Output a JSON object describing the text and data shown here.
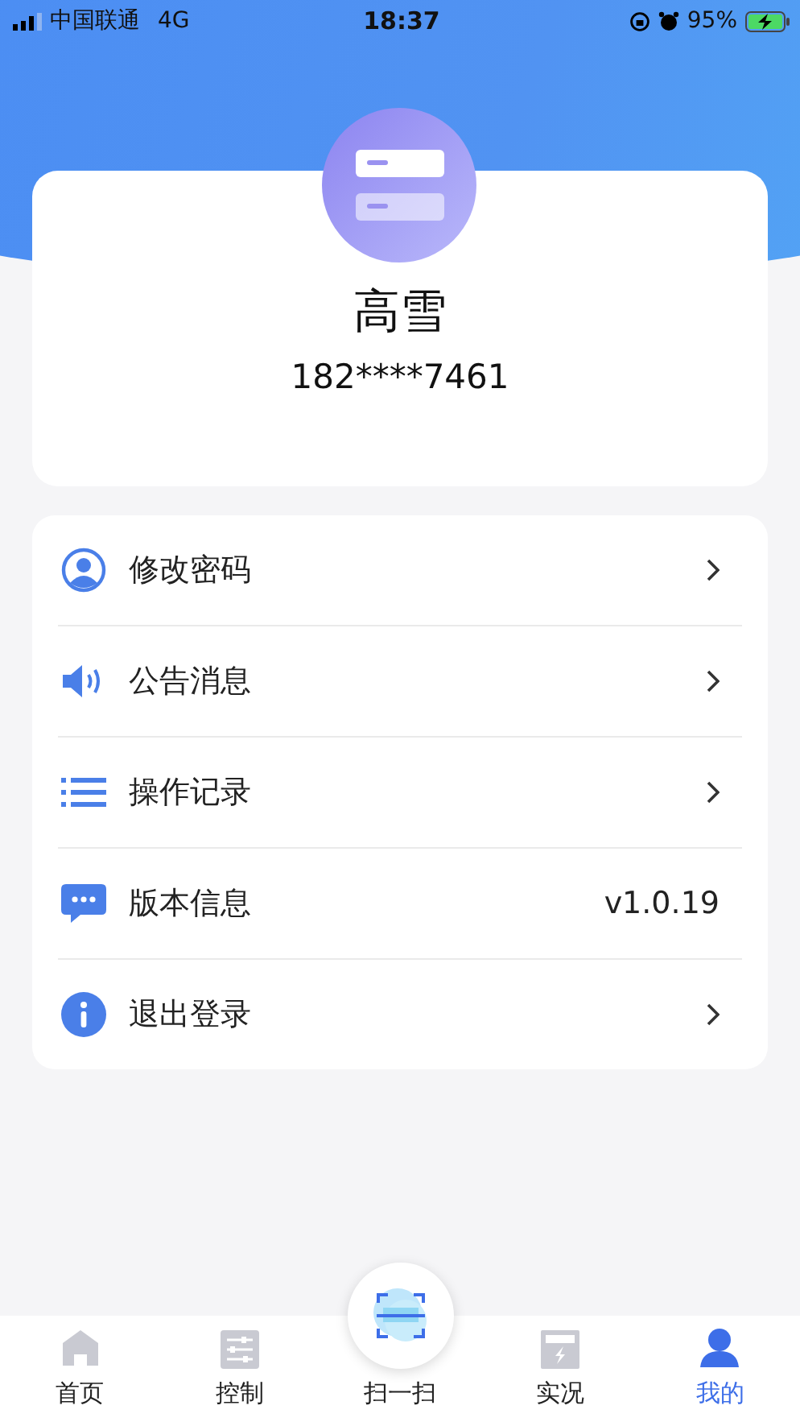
{
  "status_bar": {
    "carrier": "中国联通",
    "network": "4G",
    "time": "18:37",
    "battery": "95%"
  },
  "profile": {
    "name": "高雪",
    "phone": "182****7461"
  },
  "menu": [
    {
      "kind": "user",
      "label": "修改密码"
    },
    {
      "kind": "speaker",
      "label": "公告消息"
    },
    {
      "kind": "list",
      "label": "操作记录"
    },
    {
      "kind": "chat",
      "label": "版本信息",
      "value": "v1.0.19"
    },
    {
      "kind": "info",
      "label": "退出登录"
    }
  ],
  "tab_bar": [
    {
      "kind": "home",
      "label": "首页",
      "selected": false
    },
    {
      "kind": "control",
      "label": "控制",
      "selected": false
    },
    {
      "kind": "scan",
      "label": "扫一扫",
      "selected": false
    },
    {
      "kind": "live",
      "label": "实况",
      "selected": false
    },
    {
      "kind": "me",
      "label": "我的",
      "selected": true
    }
  ]
}
